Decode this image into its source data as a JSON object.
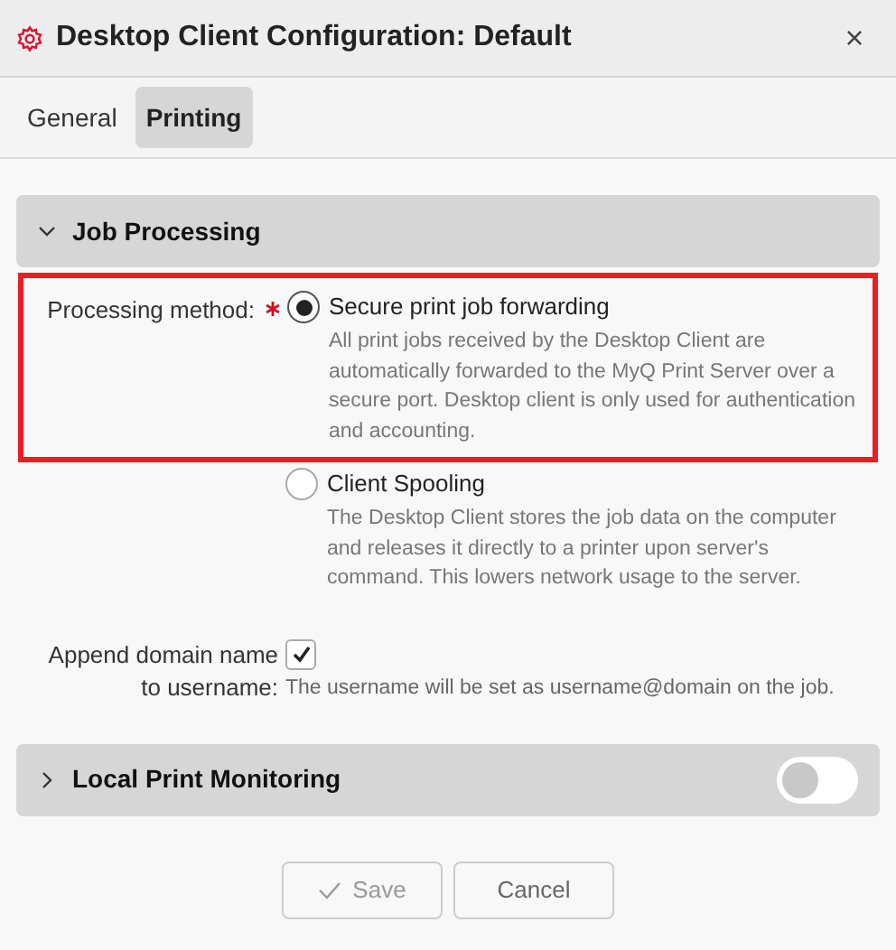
{
  "window": {
    "title": "Desktop Client Configuration: Default",
    "close": "×"
  },
  "tabs": [
    {
      "label": "General",
      "selected": false
    },
    {
      "label": "Printing",
      "selected": true
    }
  ],
  "sections": [
    {
      "title": "Job Processing",
      "expanded": true,
      "fields": [
        {
          "kind": "radio",
          "label": "Processing method:",
          "required": true,
          "highlighted": true,
          "options": [
            {
              "label": "Secure print job forwarding",
              "selected": true,
              "description": "All print jobs received by the Desktop Client are automatically forwarded to the MyQ Print Server over a secure port. Desktop client is only used for authentication and accounting."
            },
            {
              "label": "Client Spooling",
              "selected": false,
              "description": "The Desktop Client stores the job data on the computer and releases it directly to a printer upon server's command. This lowers network usage to the server."
            }
          ]
        },
        {
          "kind": "checkbox",
          "label": "Append domain name to username:",
          "checked": true,
          "description": "The username will be set as username@domain on the job."
        }
      ]
    },
    {
      "title": "Local Print Monitoring",
      "expanded": false,
      "on": false
    }
  ],
  "buttons": [
    {
      "label": "Save",
      "disabled": true,
      "icon": true
    },
    {
      "label": "Cancel",
      "disabled": false,
      "icon": false
    }
  ]
}
